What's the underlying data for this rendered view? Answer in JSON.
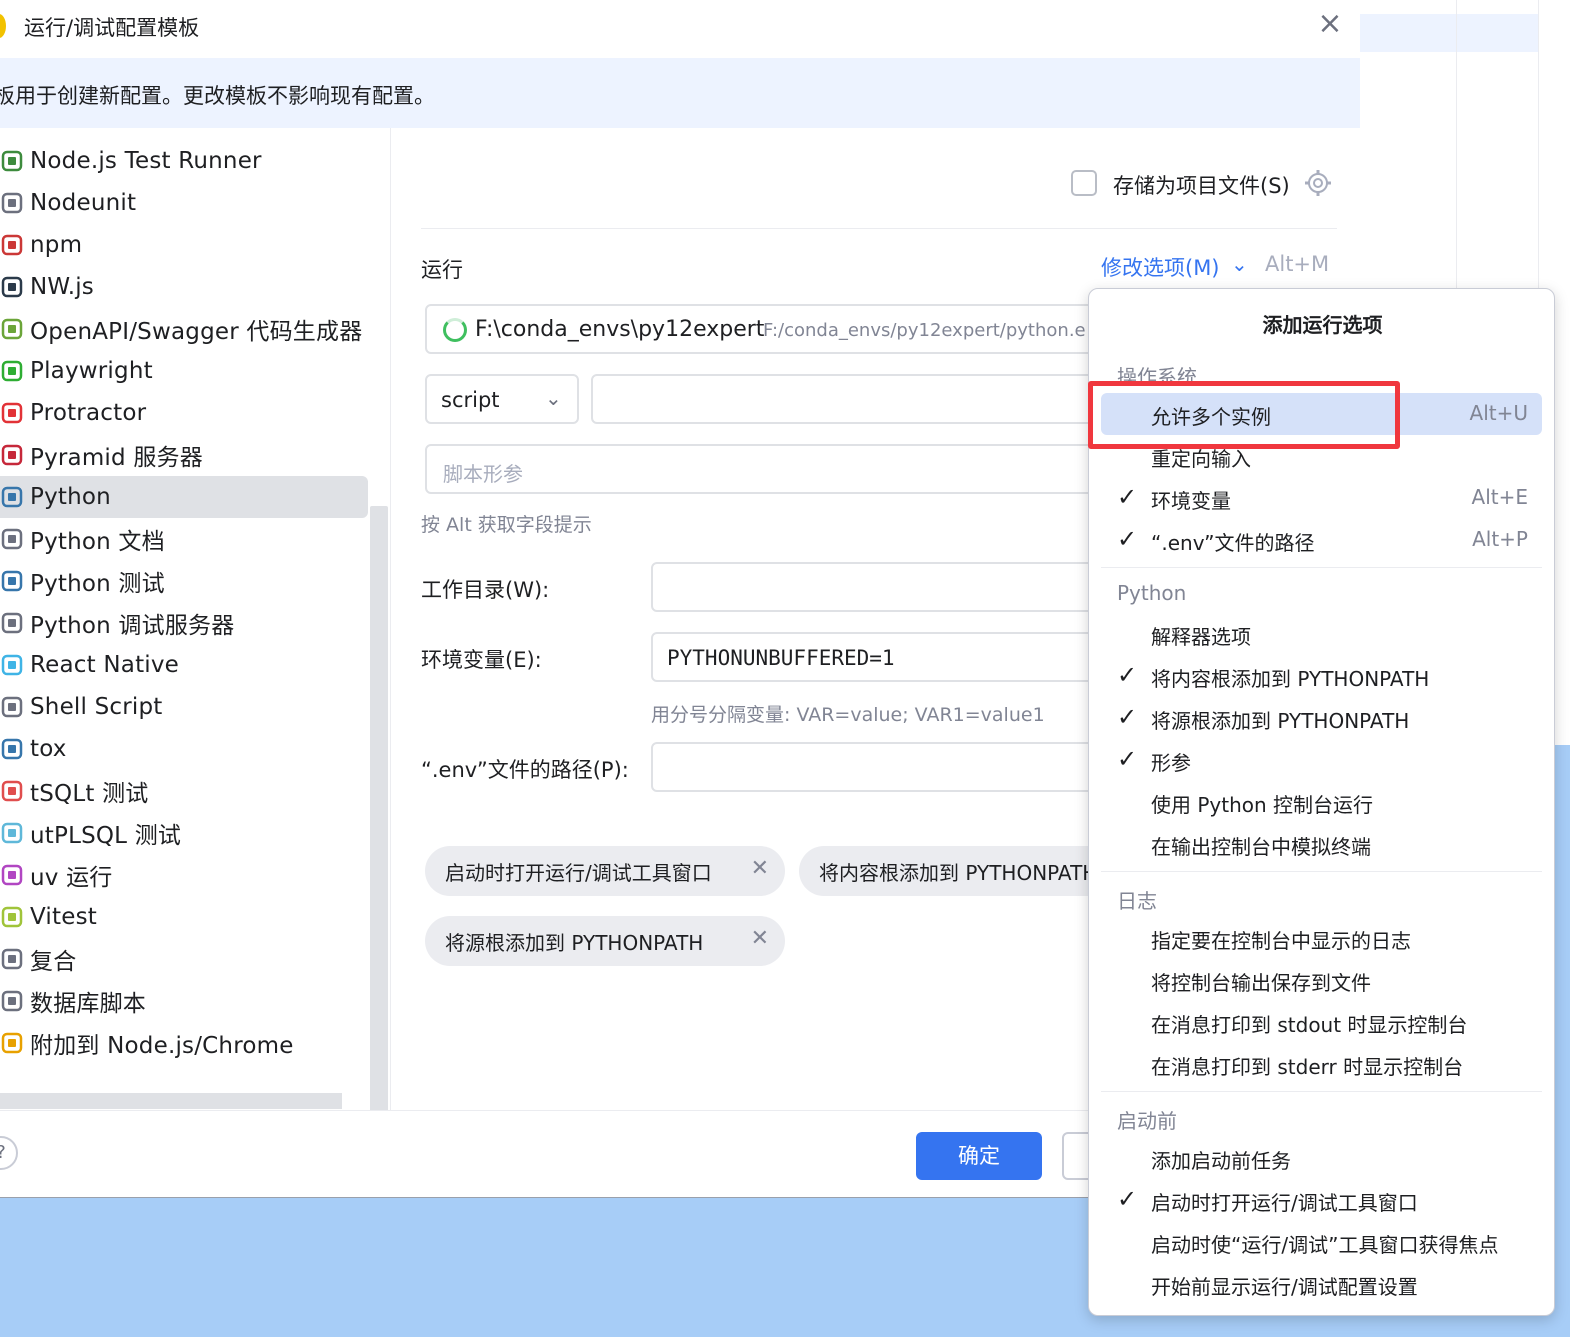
{
  "dialog": {
    "title": "运行/调试配置模板",
    "banner": "板用于创建新配置。更改模板不影响现有配置。"
  },
  "tree": {
    "items": [
      {
        "label": "Node.js Test Runner",
        "icon": "nodejs-test-icon"
      },
      {
        "label": "Nodeunit",
        "icon": "nodeunit-icon"
      },
      {
        "label": "npm",
        "icon": "npm-icon"
      },
      {
        "label": "NW.js",
        "icon": "nwjs-icon"
      },
      {
        "label": "OpenAPI/Swagger 代码生成器",
        "icon": "openapi-icon"
      },
      {
        "label": "Playwright",
        "icon": "playwright-icon"
      },
      {
        "label": "Protractor",
        "icon": "protractor-icon"
      },
      {
        "label": "Pyramid 服务器",
        "icon": "pyramid-icon"
      },
      {
        "label": "Python",
        "icon": "python-icon"
      },
      {
        "label": "Python 文档",
        "icon": "rst-doc-icon"
      },
      {
        "label": "Python 测试",
        "icon": "python-test-icon"
      },
      {
        "label": "Python 调试服务器",
        "icon": "debug-server-icon"
      },
      {
        "label": "React Native",
        "icon": "react-icon"
      },
      {
        "label": "Shell Script",
        "icon": "terminal-icon"
      },
      {
        "label": "tox",
        "icon": "tox-icon"
      },
      {
        "label": "tSQLt 测试",
        "icon": "tsqlt-icon"
      },
      {
        "label": "utPLSQL 测试",
        "icon": "database-icon"
      },
      {
        "label": "uv 运行",
        "icon": "uv-icon"
      },
      {
        "label": "Vitest",
        "icon": "vitest-icon"
      },
      {
        "label": "复合",
        "icon": "folder-icon"
      },
      {
        "label": "数据库脚本",
        "icon": "database-script-icon"
      },
      {
        "label": "附加到 Node.js/Chrome",
        "icon": "js-attach-icon"
      }
    ],
    "selected_index": 8
  },
  "main": {
    "store_as_file_label": "存储为项目文件(S)",
    "run_label": "运行",
    "modify_options": "修改选项(M)",
    "modify_shortcut": "Alt+M",
    "interpreter_name": "F:\\conda_envs\\py12expert",
    "interpreter_path": "F:/conda_envs/py12expert/python.e",
    "script_type": "script",
    "script_params_placeholder": "脚本形参",
    "alt_hint": "按 Alt 获取字段提示",
    "working_dir_label": "工作目录(W):",
    "env_vars_label": "环境变量(E):",
    "env_vars_value": "PYTHONUNBUFFERED=1",
    "env_vars_hint": "用分号分隔变量: VAR=value; VAR1=value1",
    "dotenv_label": "“.env”文件的路径(P):",
    "chips": [
      "启动时打开运行/调试工具窗口",
      "将内容根添加到 PYTHONPATH",
      "将源根添加到 PYTHONPATH"
    ]
  },
  "footer": {
    "help": "?",
    "ok": "确定"
  },
  "popup": {
    "title": "添加运行选项",
    "sections": {
      "os": "操作系统",
      "python": "Python",
      "logs": "日志",
      "before": "启动前"
    },
    "os_items": [
      {
        "label": "允许多个实例",
        "shortcut": "Alt+U",
        "checked": false
      },
      {
        "label": "重定向输入",
        "shortcut": "",
        "checked": false
      },
      {
        "label": "环境变量",
        "shortcut": "Alt+E",
        "checked": true
      },
      {
        "label": "“.env”文件的路径",
        "shortcut": "Alt+P",
        "checked": true
      }
    ],
    "python_items": [
      {
        "label": "解释器选项",
        "checked": false
      },
      {
        "label": "将内容根添加到 PYTHONPATH",
        "checked": true
      },
      {
        "label": "将源根添加到 PYTHONPATH",
        "checked": true
      },
      {
        "label": "形参",
        "checked": true
      },
      {
        "label": "使用 Python 控制台运行",
        "checked": false
      },
      {
        "label": "在输出控制台中模拟终端",
        "checked": false
      }
    ],
    "log_items": [
      {
        "label": "指定要在控制台中显示的日志",
        "checked": false
      },
      {
        "label": "将控制台输出保存到文件",
        "checked": false
      },
      {
        "label": "在消息打印到 stdout 时显示控制台",
        "checked": false
      },
      {
        "label": "在消息打印到 stderr 时显示控制台",
        "checked": false
      }
    ],
    "before_items": [
      {
        "label": "添加启动前任务",
        "checked": false
      },
      {
        "label": "启动时打开运行/调试工具窗口",
        "checked": true
      },
      {
        "label": "启动时使“运行/调试”工具窗口获得焦点",
        "checked": false
      },
      {
        "label": "开始前显示运行/调试配置设置",
        "checked": false
      }
    ],
    "check_glyph": "✓"
  },
  "colors": {
    "accent": "#3574f0",
    "highlight_box": "#f0373e",
    "selection": "#dfe1e5",
    "menu_hover": "#d5e1f9"
  }
}
